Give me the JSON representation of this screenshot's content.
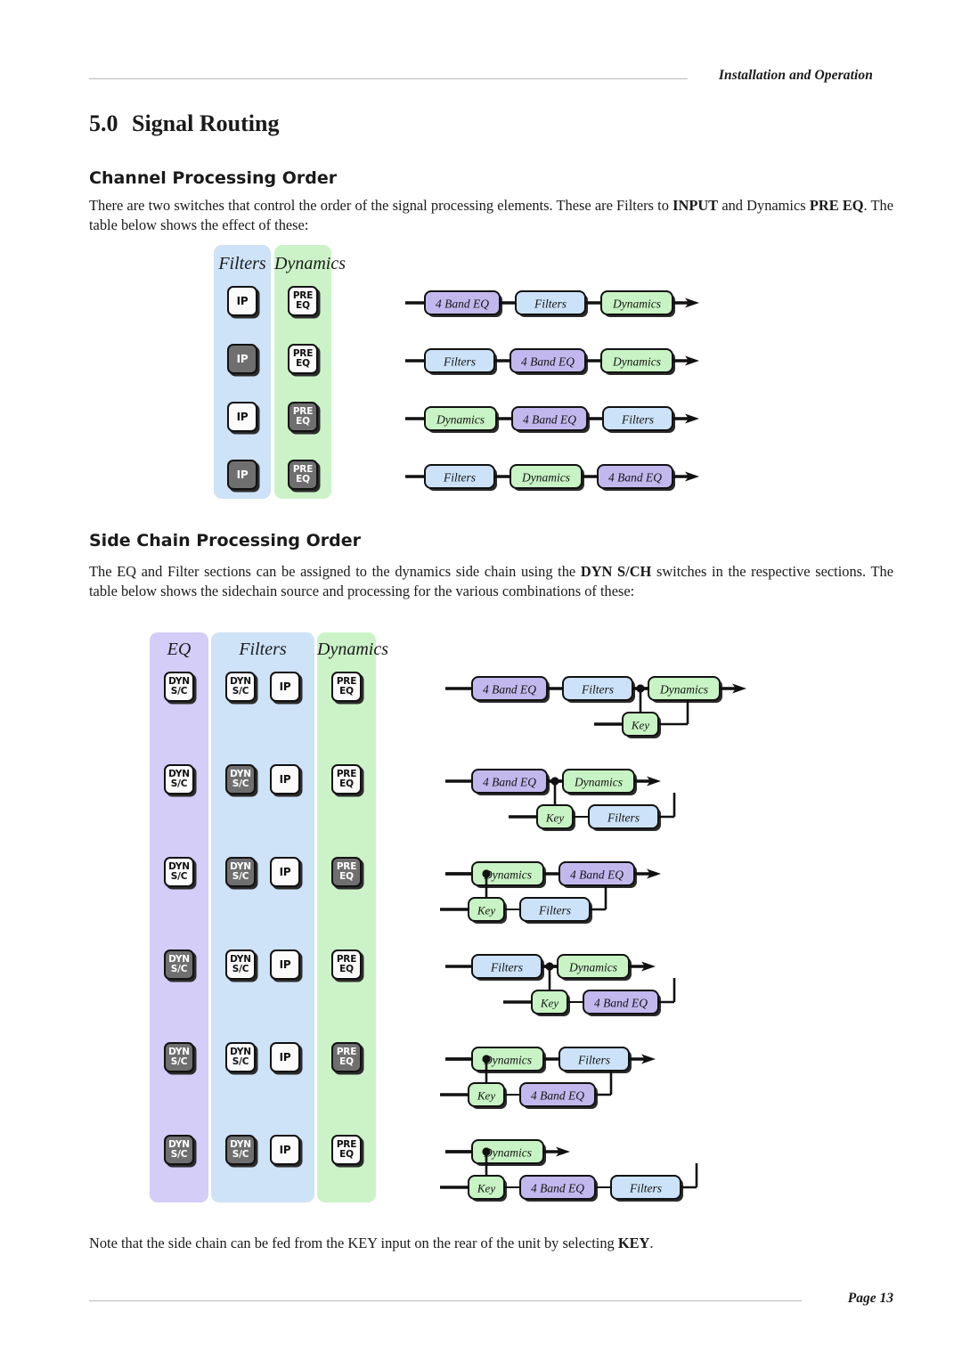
{
  "header": {
    "running_head": "Installation and Operation"
  },
  "footer": {
    "page_label": "Page 13"
  },
  "section": {
    "number": "5.0",
    "title": "Signal Routing"
  },
  "channel_processing": {
    "heading": "Channel Processing Order",
    "paragraph_html": "There are two switches that control the order of the signal processing elements. These are Filters to <b>INPUT</b> and Dynamics <b>PRE EQ</b>. The table below shows the effect of these:",
    "columns": [
      {
        "title": "Filters",
        "color": "#cee2f8",
        "switches": [
          "IP"
        ]
      },
      {
        "title": "Dynamics",
        "color": "#ccf3c8",
        "switches": [
          "PRE EQ"
        ]
      }
    ],
    "rows": [
      {
        "switch_states": {
          "IP": "off",
          "PRE EQ": "off"
        },
        "chain": [
          "4 Band EQ",
          "Filters",
          "Dynamics"
        ]
      },
      {
        "switch_states": {
          "IP": "on",
          "PRE EQ": "off"
        },
        "chain": [
          "Filters",
          "4 Band EQ",
          "Dynamics"
        ]
      },
      {
        "switch_states": {
          "IP": "off",
          "PRE EQ": "on"
        },
        "chain": [
          "Dynamics",
          "4 Band EQ",
          "Filters"
        ]
      },
      {
        "switch_states": {
          "IP": "on",
          "PRE EQ": "on"
        },
        "chain": [
          "Filters",
          "Dynamics",
          "4 Band EQ"
        ]
      }
    ]
  },
  "side_chain_processing": {
    "heading": "Side Chain Processing Order",
    "paragraph_html": "The EQ and Filter sections can be assigned to the dynamics side chain using the <b>DYN S/CH</b> switches in the respective sections. The table below shows the sidechain source and processing for the various combinations of these:",
    "columns": [
      {
        "title": "EQ",
        "color": "#d3cdf7",
        "switches": [
          "DYN S/C"
        ]
      },
      {
        "title": "Filters",
        "color": "#cee2f8",
        "switches": [
          "DYN S/C",
          "IP"
        ]
      },
      {
        "title": "Dynamics",
        "color": "#ccf3c8",
        "switches": [
          "PRE EQ"
        ]
      }
    ],
    "rows": [
      {
        "switch_states": {
          "EQ DYN S/C": "off",
          "FILT DYN S/C": "off",
          "IP": "off",
          "PRE EQ": "off"
        },
        "main_chain": [
          "4 Band EQ",
          "Filters",
          "Dynamics"
        ],
        "tap_after": 2,
        "side_chain": [
          "Key"
        ]
      },
      {
        "switch_states": {
          "EQ DYN S/C": "off",
          "FILT DYN S/C": "on",
          "IP": "off",
          "PRE EQ": "off"
        },
        "main_chain": [
          "4 Band EQ",
          "Dynamics"
        ],
        "tap_after": 1,
        "side_chain": [
          "Key",
          "Filters"
        ]
      },
      {
        "switch_states": {
          "EQ DYN S/C": "off",
          "FILT DYN S/C": "on",
          "IP": "off",
          "PRE EQ": "on"
        },
        "main_chain": [
          "Dynamics",
          "4 Band EQ"
        ],
        "tap_after": 0,
        "side_chain": [
          "Key",
          "Filters"
        ]
      },
      {
        "switch_states": {
          "EQ DYN S/C": "on",
          "FILT DYN S/C": "off",
          "IP": "off",
          "PRE EQ": "off"
        },
        "main_chain": [
          "Filters",
          "Dynamics"
        ],
        "tap_after": 1,
        "side_chain": [
          "Key",
          "4 Band EQ"
        ]
      },
      {
        "switch_states": {
          "EQ DYN S/C": "on",
          "FILT DYN S/C": "off",
          "IP": "off",
          "PRE EQ": "on"
        },
        "main_chain": [
          "Dynamics",
          "Filters"
        ],
        "tap_after": 0,
        "side_chain": [
          "Key",
          "4 Band EQ"
        ]
      },
      {
        "switch_states": {
          "EQ DYN S/C": "on",
          "FILT DYN S/C": "on",
          "IP": "off",
          "PRE EQ": "off"
        },
        "main_chain": [
          "Dynamics"
        ],
        "tap_after": 0,
        "side_chain": [
          "Key",
          "4 Band EQ",
          "Filters"
        ]
      }
    ]
  },
  "note": {
    "text_html": "Note that the side chain can be fed from the KEY input on the rear of the unit by selecting <b>KEY</b>."
  },
  "block_colors": {
    "4 Band EQ": "#c3b8ee",
    "Filters": "#cbe2f8",
    "Dynamics": "#c8f3c4",
    "Key": "#c8f3c4",
    "line": "#111111",
    "switch_on": "#6f6f6f",
    "switch_off": "#fbfbfb"
  }
}
